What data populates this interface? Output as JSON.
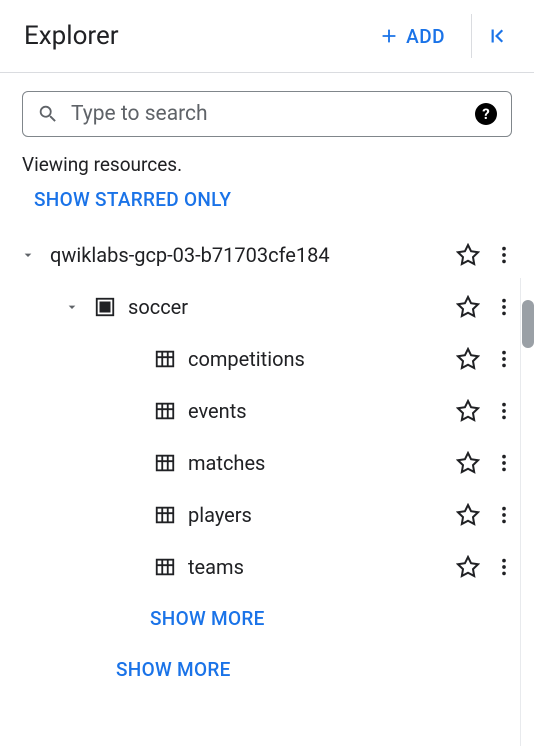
{
  "header": {
    "title": "Explorer",
    "add_label": "ADD"
  },
  "search": {
    "placeholder": "Type to search"
  },
  "status_text": "Viewing resources.",
  "starred_link": "SHOW STARRED ONLY",
  "tree": {
    "project": {
      "label": "qwiklabs-gcp-03-b71703cfe184"
    },
    "dataset": {
      "label": "soccer"
    },
    "tables": [
      {
        "label": "competitions"
      },
      {
        "label": "events"
      },
      {
        "label": "matches"
      },
      {
        "label": "players"
      },
      {
        "label": "teams"
      }
    ],
    "show_more_tables": "SHOW MORE",
    "show_more_datasets": "SHOW MORE"
  }
}
